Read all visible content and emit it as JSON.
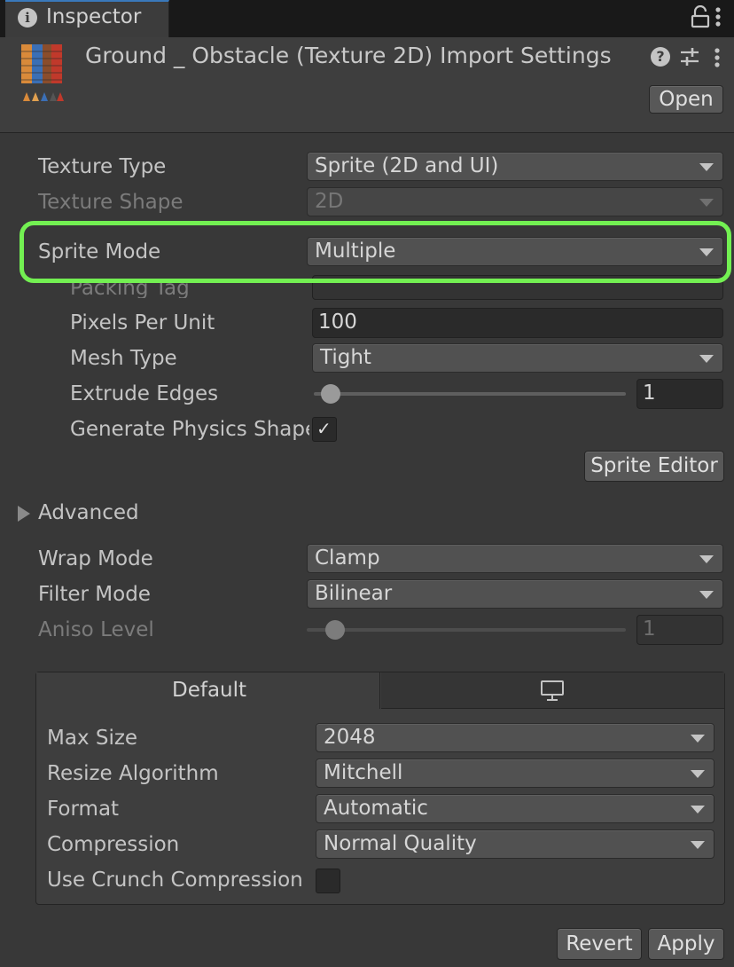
{
  "tab": {
    "label": "Inspector"
  },
  "header": {
    "title": "Ground _ Obstacle (Texture 2D) Import Settings",
    "open_label": "Open",
    "help_label": "?"
  },
  "fields": {
    "texture_type": {
      "label": "Texture Type",
      "value": "Sprite (2D and UI)"
    },
    "texture_shape": {
      "label": "Texture Shape",
      "value": "2D"
    },
    "sprite_mode": {
      "label": "Sprite Mode",
      "value": "Multiple"
    },
    "packing_tag": {
      "label": "Packing Tag",
      "value": ""
    },
    "pixels_per_unit": {
      "label": "Pixels Per Unit",
      "value": "100"
    },
    "mesh_type": {
      "label": "Mesh Type",
      "value": "Tight"
    },
    "extrude_edges": {
      "label": "Extrude Edges",
      "value": "1"
    },
    "generate_physics_shape": {
      "label": "Generate Physics Shape",
      "checked": true,
      "check_glyph": "✓"
    },
    "sprite_editor_label": "Sprite Editor",
    "advanced_label": "Advanced",
    "wrap_mode": {
      "label": "Wrap Mode",
      "value": "Clamp"
    },
    "filter_mode": {
      "label": "Filter Mode",
      "value": "Bilinear"
    },
    "aniso_level": {
      "label": "Aniso Level",
      "value": "1"
    }
  },
  "platform": {
    "tab_default": "Default",
    "tab_standalone_icon": "monitor-icon",
    "max_size": {
      "label": "Max Size",
      "value": "2048"
    },
    "resize_algorithm": {
      "label": "Resize Algorithm",
      "value": "Mitchell"
    },
    "format": {
      "label": "Format",
      "value": "Automatic"
    },
    "compression": {
      "label": "Compression",
      "value": "Normal Quality"
    },
    "use_crunch": {
      "label": "Use Crunch Compression",
      "checked": false
    }
  },
  "footer": {
    "revert_label": "Revert",
    "apply_label": "Apply"
  },
  "colors": {
    "highlight": "#73f052",
    "background": "#383838",
    "tab_accent": "#3a79bb"
  }
}
